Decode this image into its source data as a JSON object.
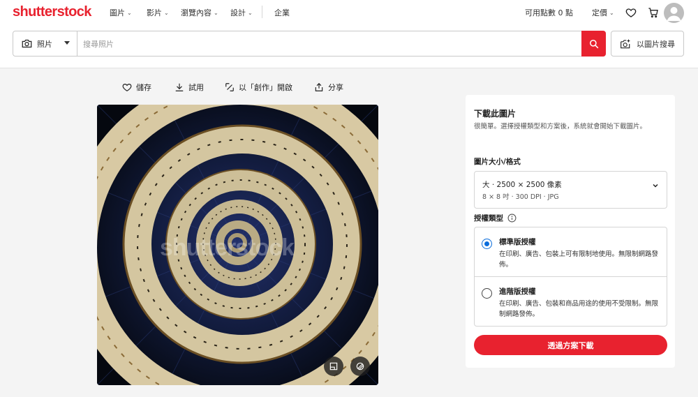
{
  "brand": {
    "logo": "shutterstock",
    "accent": "#e8222f",
    "link_blue": "#0a6cdb"
  },
  "nav": {
    "items": [
      {
        "label": "圖片"
      },
      {
        "label": "影片"
      },
      {
        "label": "瀏覽內容"
      },
      {
        "label": "設計"
      }
    ],
    "enterprise": "企業",
    "credits": "可用點數 0 點",
    "pricing": "定價",
    "icons": [
      "heart-icon",
      "cart-icon",
      "user-avatar-icon"
    ]
  },
  "search": {
    "type": "照片",
    "placeholder": "搜尋照片",
    "image_search": "以圖片搜尋"
  },
  "actions": {
    "save": "儲存",
    "try": "試用",
    "create": "以「創作」開啟",
    "share": "分享"
  },
  "image": {
    "watermark": "shutterstock"
  },
  "panel": {
    "title": "下載此圖片",
    "subtitle": "很簡單。選擇授權類型和方案後，系統就會開始下載圖片。",
    "size_label": "圖片大小/格式",
    "size_main": "大 · 2500 × 2500 像素",
    "size_spec": "8 × 8 吋 · 300 DPI · JPG",
    "license_label": "授權類型",
    "licenses": [
      {
        "name": "標準版授權",
        "desc": "在印刷、廣告、包裝上可有限制地使用。無限制網路發佈。",
        "selected": true
      },
      {
        "name": "進階版授權",
        "desc": "在印刷、廣告、包裝和商品用途的使用不受限制。無限制網路發佈。",
        "selected": false
      }
    ],
    "download": "透過方案下載"
  }
}
